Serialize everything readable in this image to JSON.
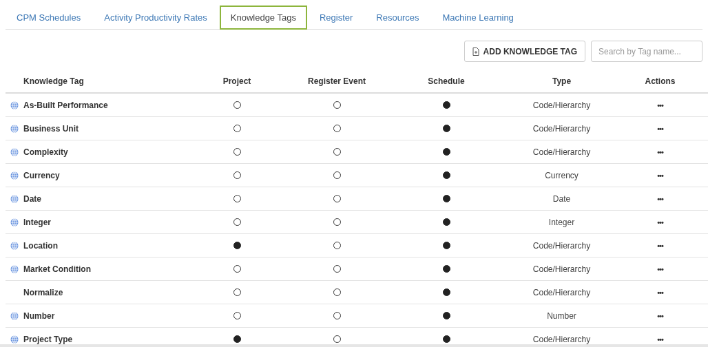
{
  "tabs": [
    {
      "label": "CPM Schedules",
      "selected": false
    },
    {
      "label": "Activity Productivity Rates",
      "selected": false
    },
    {
      "label": "Knowledge Tags",
      "selected": true
    },
    {
      "label": "Register",
      "selected": false
    },
    {
      "label": "Resources",
      "selected": false
    },
    {
      "label": "Machine Learning",
      "selected": false
    }
  ],
  "toolbar": {
    "add_button": "ADD KNOWLEDGE TAG",
    "search": {
      "placeholder": "Search by Tag name..."
    }
  },
  "table": {
    "columns": [
      "Knowledge Tag",
      "Project",
      "Register Event",
      "Schedule",
      "Type",
      "Actions"
    ],
    "rows": [
      {
        "global": true,
        "name": "As-Built Performance",
        "project": false,
        "register_event": false,
        "schedule": true,
        "type": "Code/Hierarchy",
        "actions": "•••"
      },
      {
        "global": true,
        "name": "Business Unit",
        "project": false,
        "register_event": false,
        "schedule": true,
        "type": "Code/Hierarchy",
        "actions": "•••"
      },
      {
        "global": true,
        "name": "Complexity",
        "project": false,
        "register_event": false,
        "schedule": true,
        "type": "Code/Hierarchy",
        "actions": "•••"
      },
      {
        "global": true,
        "name": "Currency",
        "project": false,
        "register_event": false,
        "schedule": true,
        "type": "Currency",
        "actions": "•••"
      },
      {
        "global": true,
        "name": "Date",
        "project": false,
        "register_event": false,
        "schedule": true,
        "type": "Date",
        "actions": "•••"
      },
      {
        "global": true,
        "name": "Integer",
        "project": false,
        "register_event": false,
        "schedule": true,
        "type": "Integer",
        "actions": "•••"
      },
      {
        "global": true,
        "name": "Location",
        "project": true,
        "register_event": false,
        "schedule": true,
        "type": "Code/Hierarchy",
        "actions": "•••"
      },
      {
        "global": true,
        "name": "Market Condition",
        "project": false,
        "register_event": false,
        "schedule": true,
        "type": "Code/Hierarchy",
        "actions": "•••"
      },
      {
        "global": false,
        "name": "Normalize",
        "project": false,
        "register_event": false,
        "schedule": true,
        "type": "Code/Hierarchy",
        "actions": "•••"
      },
      {
        "global": true,
        "name": "Number",
        "project": false,
        "register_event": false,
        "schedule": true,
        "type": "Number",
        "actions": "•••"
      },
      {
        "global": true,
        "name": "Project Type",
        "project": true,
        "register_event": false,
        "schedule": true,
        "type": "Code/Hierarchy",
        "actions": "•••"
      }
    ]
  }
}
